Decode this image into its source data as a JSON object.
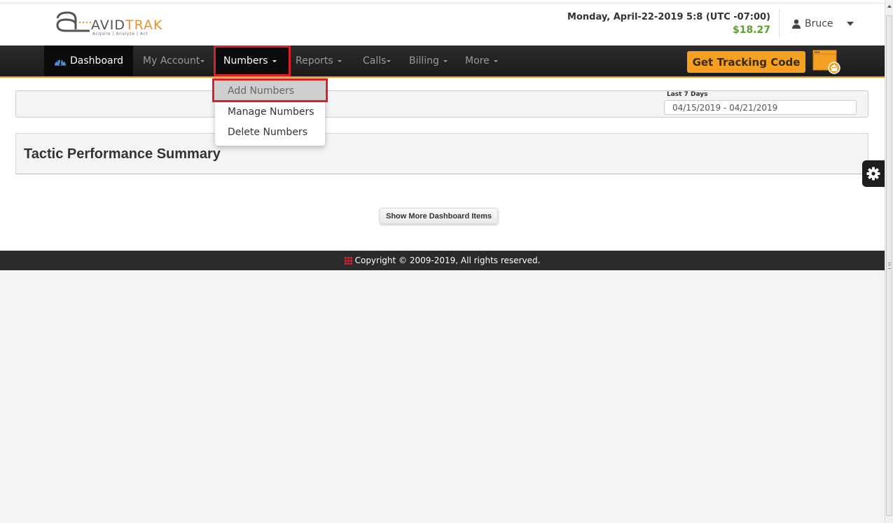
{
  "header": {
    "logo": {
      "brand_left": "AVID",
      "brand_right": "TRAK",
      "tagline": "Acquire  |  Analyze  |  Act"
    },
    "datetime": "Monday, April-22-2019 5:8 (UTC -07:00)",
    "balance": "$18.27",
    "user_name": "Bruce",
    "icons": {
      "user": "user-icon",
      "caret": "caret-down-icon"
    }
  },
  "nav": {
    "items": [
      {
        "label": "Dashboard",
        "icon": "dashboard-gauge-icon"
      },
      {
        "label": "My Account"
      },
      {
        "label": "Numbers"
      },
      {
        "label": "Reports"
      },
      {
        "label": "Calls"
      },
      {
        "label": "Billing"
      },
      {
        "label": "More"
      }
    ],
    "tracking_button": "Get Tracking Code",
    "tracking_icon": "browser-home-icon"
  },
  "numbers_dropdown": {
    "items": [
      {
        "label": "Add Numbers",
        "active": true
      },
      {
        "label": "Manage Numbers"
      },
      {
        "label": "Delete Numbers"
      }
    ]
  },
  "filter": {
    "date_label": "Last 7 Days",
    "date_range": "04/15/2019 - 04/21/2019"
  },
  "tactic_panel": {
    "title": "Tactic Performance Summary"
  },
  "settings_tab": {
    "icon": "gear-icon"
  },
  "show_more_button": "Show More Dashboard Items",
  "footer": {
    "text": "Copyright © 2009-2019, All rights reserved.",
    "icon": "grid-icon",
    "icon_color": "#d9202a"
  },
  "colors": {
    "accent_orange": "#f5a023",
    "highlight_red": "#d9202a",
    "balance_green": "#5aa02c",
    "nav_bg": "#1c1c1c"
  }
}
